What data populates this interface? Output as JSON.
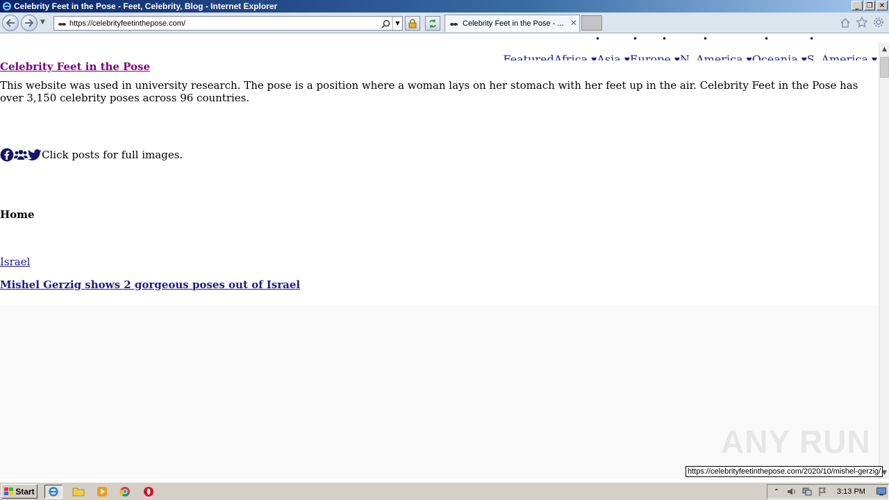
{
  "window": {
    "title": "Celebrity Feet in the Pose - Feet, Celebrity, Blog - Internet Explorer",
    "buttons": [
      "_",
      "❐",
      "✕"
    ]
  },
  "navbar": {
    "url": "https://celebrityfeetinthepose.com/",
    "tab_title": "Celebrity Feet in the Pose - ...",
    "tab_close": "✕"
  },
  "page": {
    "topnav": [
      "Featured",
      "Africa ▾",
      "Asia ▾",
      "Europe ▾",
      "N. America ▾",
      "Oceania ▾",
      "S. America ▾"
    ],
    "site_title": "Celebrity Feet in the Pose",
    "intro": "This website was used in university research. The pose is a position where a woman lays on her stomach with her feet up in the air. Celebrity Feet in the Pose has over 3,150 celebrity poses across 96 countries.",
    "social_text": "Click posts for full images.",
    "home_heading": "Home",
    "category_link": "Israel",
    "post_title": "Mishel Gerzig shows 2 gorgeous poses out of Israel"
  },
  "status_bar_url": "https://celebrityfeetinthepose.com/2020/10/mishel-gerzig/",
  "watermark": "ANY RUN",
  "taskbar": {
    "start_label": "Start",
    "clock": "3:13 PM"
  },
  "colors": {
    "visited_link": "#800080",
    "link": "#1a1a8c",
    "titlebar": "#0a246a"
  }
}
